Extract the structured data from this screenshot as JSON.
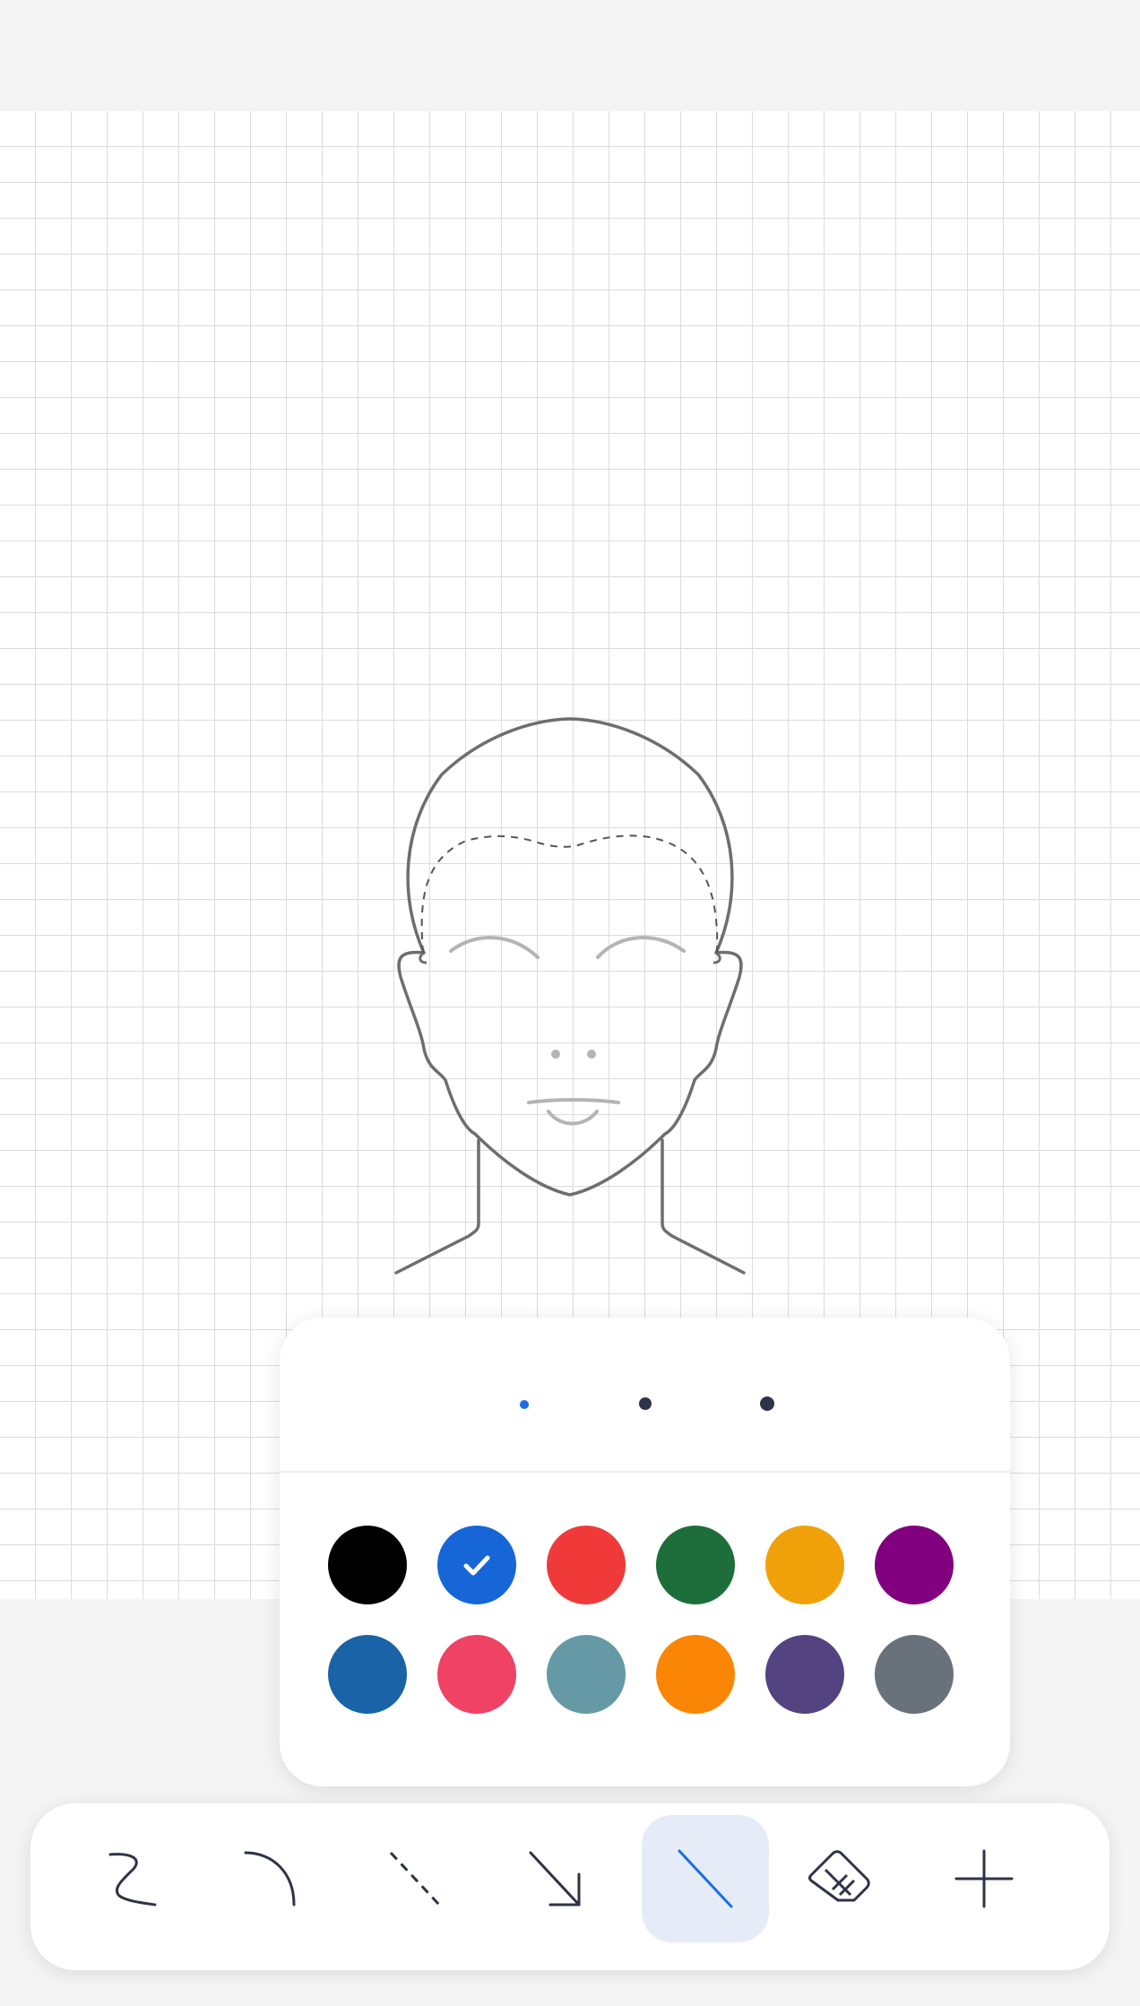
{
  "stroke_sizes": [
    {
      "name": "small",
      "selected": true,
      "color": "#1a6ee6"
    },
    {
      "name": "medium",
      "selected": false,
      "color": "#2e3347"
    },
    {
      "name": "large",
      "selected": false,
      "color": "#2e3347"
    }
  ],
  "palette": [
    {
      "name": "black",
      "hex": "#000000",
      "selected": false
    },
    {
      "name": "blue",
      "hex": "#1666d8",
      "selected": true
    },
    {
      "name": "red",
      "hex": "#f03a3a",
      "selected": false
    },
    {
      "name": "green",
      "hex": "#1d6e3a",
      "selected": false
    },
    {
      "name": "amber",
      "hex": "#f0a10a",
      "selected": false
    },
    {
      "name": "purple",
      "hex": "#81007f",
      "selected": false
    },
    {
      "name": "steel-blue",
      "hex": "#1a63a6",
      "selected": false
    },
    {
      "name": "pink",
      "hex": "#f04265",
      "selected": false
    },
    {
      "name": "teal-grey",
      "hex": "#6599a6",
      "selected": false
    },
    {
      "name": "orange",
      "hex": "#fb8505",
      "selected": false
    },
    {
      "name": "indigo",
      "hex": "#534381",
      "selected": false
    },
    {
      "name": "slate",
      "hex": "#69727a",
      "selected": false
    }
  ],
  "tools": [
    {
      "name": "freehand-tool",
      "icon": "squiggle-icon",
      "selected": false
    },
    {
      "name": "curve-tool",
      "icon": "arc-icon",
      "selected": false
    },
    {
      "name": "dashed-line-tool",
      "icon": "dashed-line-icon",
      "selected": false
    },
    {
      "name": "arrow-tool",
      "icon": "arrow-icon",
      "selected": false
    },
    {
      "name": "line-tool",
      "icon": "line-icon",
      "selected": true
    },
    {
      "name": "eraser-tool",
      "icon": "eraser-icon",
      "selected": false
    },
    {
      "name": "add-tool",
      "icon": "plus-icon",
      "selected": false
    }
  ],
  "colors": {
    "accent": "#1a6ee6",
    "selected_tool_bg": "#e5ecf8",
    "icon": "#2e3347",
    "face_outline": "#6e6e6e",
    "face_detail": "#b4b4b4"
  }
}
